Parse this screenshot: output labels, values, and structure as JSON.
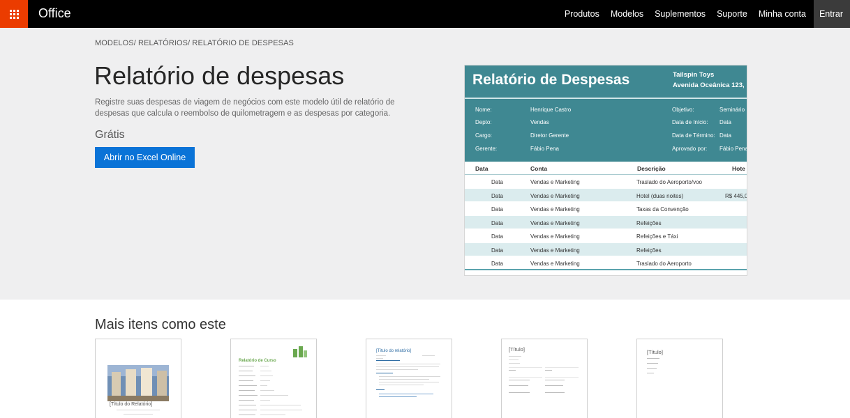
{
  "topbar": {
    "brand": "Office",
    "nav": [
      "Produtos",
      "Modelos",
      "Suplementos",
      "Suporte",
      "Minha conta"
    ],
    "signin": "Entrar"
  },
  "hero": {
    "breadcrumb": "MODELOS/ RELATÓRIOS/ RELATÓRIO DE DESPESAS",
    "title": "Relatório de despesas",
    "description": "Registre suas despesas de viagem de negócios com este modelo útil de relatório de despesas que calcula o reembolso de quilometragem e as despesas por categoria.",
    "price": "Grátis",
    "open_button": "Abrir no Excel Online"
  },
  "preview": {
    "title": "Relatório de Despesas",
    "company": "Tailspin Toys",
    "address": "Avenida Oceânica 123,",
    "left_fields": [
      {
        "label": "Nome:",
        "value": "Henrique Castro"
      },
      {
        "label": "Depto:",
        "value": "Vendas"
      },
      {
        "label": "Cargo:",
        "value": "Diretor Gerente"
      },
      {
        "label": "Gerente:",
        "value": "Fábio Pena"
      }
    ],
    "right_fields": [
      {
        "label": "Objetivo:",
        "value": "Seminário"
      },
      {
        "label": "Data de Início:",
        "value": "Data"
      },
      {
        "label": "Data de Término:",
        "value": "Data"
      },
      {
        "label": "Aprovado por:",
        "value": "Fábio Pena"
      }
    ],
    "columns": [
      "Data",
      "Conta",
      "Descrição",
      "Hote"
    ],
    "rows": [
      {
        "date": "Data",
        "account": "Vendas e Marketing",
        "description": "Traslado do Aeroporto/voo",
        "hotel": ""
      },
      {
        "date": "Data",
        "account": "Vendas e Marketing",
        "description": "Hotel (duas noites)",
        "hotel": "R$ 445,0"
      },
      {
        "date": "Data",
        "account": "Vendas e Marketing",
        "description": "Taxas da Convenção",
        "hotel": ""
      },
      {
        "date": "Data",
        "account": "Vendas e Marketing",
        "description": "Refeições",
        "hotel": ""
      },
      {
        "date": "Data",
        "account": "Vendas e Marketing",
        "description": "Refeições e Táxi",
        "hotel": ""
      },
      {
        "date": "Data",
        "account": "Vendas e Marketing",
        "description": "Refeições",
        "hotel": ""
      },
      {
        "date": "Data",
        "account": "Vendas e Marketing",
        "description": "Traslado do Aeroporto",
        "hotel": ""
      }
    ]
  },
  "related": {
    "title": "Mais itens como este",
    "thumbs": [
      {
        "caption": "[Título do Relatório]"
      },
      {
        "caption": "Relatório de Curso"
      },
      {
        "caption": "[Título do relatório]"
      },
      {
        "caption": "[Título]"
      },
      {
        "caption": "[Título]"
      }
    ]
  },
  "colors": {
    "accent": "#0a73d7",
    "brand_tile": "#eb3c00",
    "preview_header": "#3f8892",
    "row_alt": "#dbecee"
  }
}
